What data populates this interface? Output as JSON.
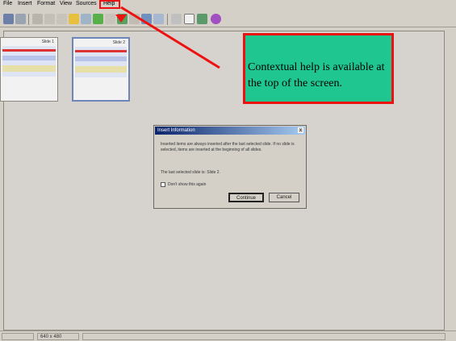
{
  "menubar": {
    "items": [
      "File",
      "Insert",
      "Format",
      "View",
      "Sources",
      "Help"
    ]
  },
  "slides": [
    {
      "title": "Slide 1"
    },
    {
      "title": "Slide 2"
    }
  ],
  "callout": {
    "text": "Contextual help is available at the top of the screen."
  },
  "dialog": {
    "title": "Insert Information",
    "close_label": "x",
    "message": "Inserted items are always inserted after the last selected slide. If no slide is selected, items are inserted at the beginning of all slides.",
    "note": "The last selected slide is: Slide 2.",
    "checkbox_label": "Don't show this again",
    "continue_label": "Continue",
    "cancel_label": "Cancel"
  },
  "statusbar": {
    "left": "",
    "size": "640 x 480"
  },
  "colors": {
    "callout_bg": "#1fc690",
    "highlight_red": "#ee1111",
    "dialog_title": "#0a246a"
  }
}
